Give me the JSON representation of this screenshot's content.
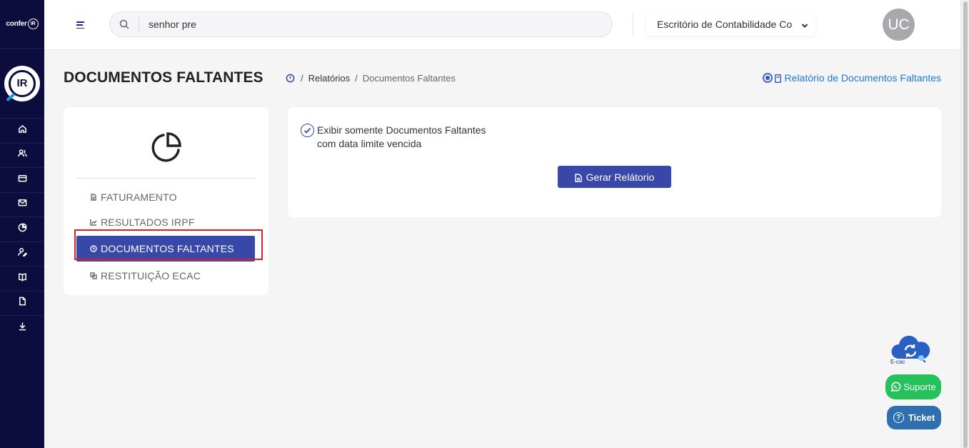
{
  "brand": {
    "small_text": "confer",
    "badge": "IR",
    "logo_text": "IR"
  },
  "topbar": {
    "search": {
      "value": "senhor pre",
      "placeholder": ""
    },
    "office_select": "Escritório de Contabilidade Co",
    "avatar_initials": "UC"
  },
  "rail_nav": [
    "home-icon",
    "users-icon",
    "card-icon",
    "mail-icon",
    "chart-pie-icon",
    "user-edit-icon",
    "book-icon",
    "file-icon",
    "download-icon"
  ],
  "page": {
    "title": "DOCUMENTOS FALTANTES",
    "breadcrumb": {
      "sep": "/",
      "parent": "Relatórios",
      "current": "Documentos Faltantes"
    },
    "report_link": "Relatório de Documentos Faltantes"
  },
  "report_menu": [
    {
      "label": "FATURAMENTO",
      "icon": "file-icon",
      "active": false
    },
    {
      "label": "RESULTADOS IRPF",
      "icon": "line-chart-icon",
      "active": false
    },
    {
      "label": "DOCUMENTOS FALTANTES",
      "icon": "clock-icon",
      "active": true
    },
    {
      "label": "RESTITUIÇÃO ECAC",
      "icon": "copy-icon",
      "active": false
    }
  ],
  "filter": {
    "checkbox_label": "Exibir somente Documentos Faltantes com data limite vencida",
    "checked": true
  },
  "generate_button": "Gerar Relátorio",
  "floating": {
    "ecac_label": "E-cac",
    "suporte": "Suporte",
    "ticket": "Ticket",
    "ticket_icon": "?"
  },
  "colors": {
    "rail_bg": "#0c0c3e",
    "primary": "#3848a8",
    "link": "#1f7ad6",
    "whatsapp": "#25c15a",
    "ticket": "#2e6fb0",
    "highlight": "#e02020"
  }
}
